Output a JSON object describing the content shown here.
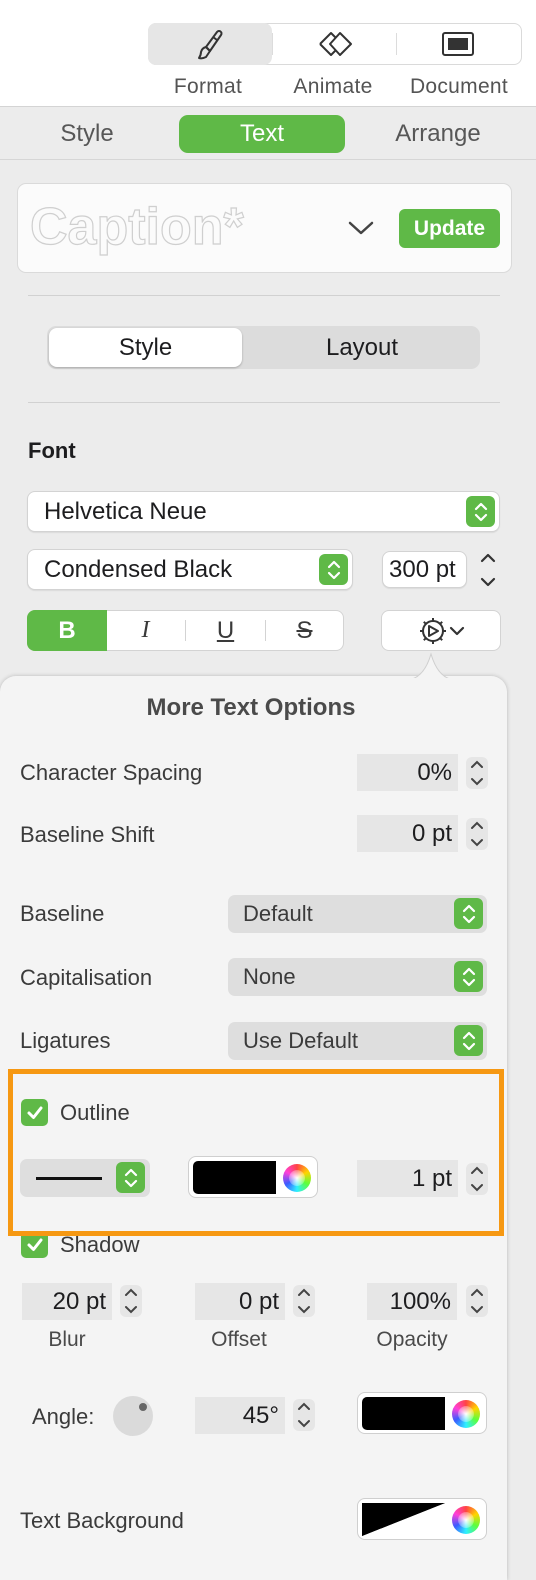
{
  "toolbar": {
    "format_label": "Format",
    "animate_label": "Animate",
    "document_label": "Document",
    "active": "Format"
  },
  "tabs": {
    "style": "Style",
    "text": "Text",
    "arrange": "Arrange",
    "active": "Text"
  },
  "paragraph_style": {
    "name": "Caption*",
    "update_label": "Update"
  },
  "subtabs": {
    "style": "Style",
    "layout": "Layout",
    "active": "Style"
  },
  "font": {
    "heading": "Font",
    "family": "Helvetica Neue",
    "typeface": "Condensed Black",
    "size": "300 pt",
    "bold_glyph": "B",
    "italic_glyph": "I",
    "underline_glyph": "U",
    "strike_glyph": "S",
    "bold_active": true
  },
  "more_options": {
    "title": "More Text Options",
    "character_spacing": {
      "label": "Character Spacing",
      "value": "0%"
    },
    "baseline_shift": {
      "label": "Baseline Shift",
      "value": "0 pt"
    },
    "baseline": {
      "label": "Baseline",
      "value": "Default"
    },
    "capitalisation": {
      "label": "Capitalisation",
      "value": "None"
    },
    "ligatures": {
      "label": "Ligatures",
      "value": "Use Default"
    },
    "outline": {
      "label": "Outline",
      "checked": true,
      "color": "#000000",
      "width": "1 pt",
      "highlight_color": "#f69812"
    },
    "shadow": {
      "label": "Shadow",
      "checked": true,
      "blur": {
        "value": "20 pt",
        "label": "Blur"
      },
      "offset": {
        "value": "0 pt",
        "label": "Offset"
      },
      "opacity": {
        "value": "100%",
        "label": "Opacity"
      },
      "angle_label": "Angle:",
      "angle_value": "45°",
      "color": "#000000"
    },
    "text_background": {
      "label": "Text Background"
    }
  },
  "colors": {
    "accent": "#5fb947",
    "panel": "#ececec",
    "popover": "#f4f4f4"
  }
}
